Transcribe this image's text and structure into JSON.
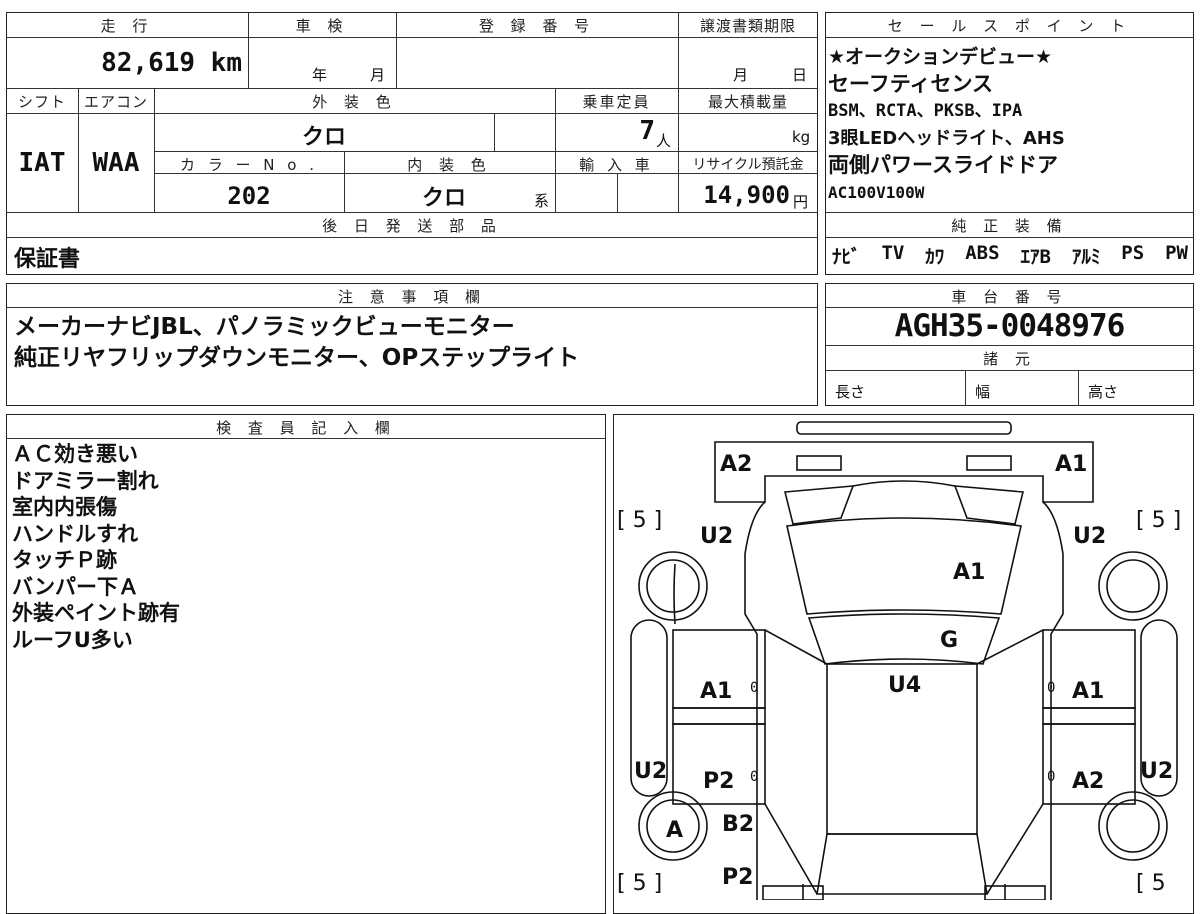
{
  "main": {
    "headers": {
      "mileage": "走 行",
      "inspection": "車 検",
      "registration": "登 録 番 号",
      "transfer_deadline": "譲渡書類期限",
      "shift": "シフト",
      "aircon": "エアコン",
      "ext_color": "外 装 色",
      "capacity": "乗車定員",
      "max_load": "最大積載量",
      "color_no": "カ ラ ー N o .",
      "int_color": "内 装 色",
      "import": "輸 入 車",
      "recycle": "リサイクル預託金",
      "later_parts": "後 日 発 送 部 品"
    },
    "mileage": "82,619 km",
    "inspection_year_unit": "年",
    "inspection_month_unit": "月",
    "transfer_month_unit": "月",
    "transfer_day_unit": "日",
    "shift": "IAT",
    "aircon": "WAA",
    "ext_color": "クロ",
    "capacity": "7",
    "capacity_unit": "人",
    "max_load_unit": "kg",
    "color_no": "202",
    "int_color": "クロ",
    "int_color_suffix": "系",
    "recycle": "14,900",
    "recycle_unit": "円",
    "later_parts": "保証書"
  },
  "sales": {
    "header": "セ ー ル ス ポ イ ン ト",
    "lines": [
      "★オークションデビュー★",
      "セーフティセンス",
      "BSM、RCTA、PKSB、IPA",
      "3眼LEDヘッドライト、AHS",
      "両側パワースライドドア",
      "AC100V100W"
    ]
  },
  "equipment": {
    "header": "純 正 装 備",
    "items": [
      "ﾅﾋﾞ",
      "TV",
      "ｶﾜ",
      "ABS",
      "ｴｱB",
      "ｱﾙﾐ",
      "PS",
      "PW"
    ]
  },
  "notes": {
    "header": "注 意 事 項 欄",
    "lines": [
      "メーカーナビJBL、パノラミックビューモニター",
      "純正リヤフリップダウンモニター、OPステップライト"
    ]
  },
  "chassis": {
    "header": "車 台 番 号",
    "number": "AGH35-0048976"
  },
  "specs": {
    "header": "諸 元",
    "length": "長さ",
    "width": "幅",
    "height": "高さ"
  },
  "inspector": {
    "header": "検 査 員 記 入 欄",
    "lines": [
      "ＡＣ効き悪い",
      "ドアミラー割れ",
      "室内内張傷",
      "ハンドルすれ",
      "タッチＰ跡",
      "バンパー下Ａ",
      "外装ペイント跡有",
      "ルーフU多い"
    ]
  },
  "diagram": {
    "bracket_left_top": "[ 5 ]",
    "bracket_right_top": "[ 5 ]",
    "bracket_left_bottom": "[ 5 ]",
    "bracket_right_bottom": "[ 5",
    "marks": {
      "front_left_corner": "A2",
      "front_right_corner": "A1",
      "left_fender": "U2",
      "right_fender": "U2",
      "hood": "A1",
      "windshield": "G",
      "roof": "U4",
      "left_front_door": "A1",
      "right_front_door": "A1",
      "left_rear_pillar": "U2",
      "right_rear_pillar": "U2",
      "left_rear_door": "P2",
      "right_rear_door": "A2",
      "left_rear_wheel": "A",
      "left_quarter": "B2",
      "left_rear_corner": "P2"
    },
    "zero_marks": [
      "0",
      "0",
      "0",
      "0"
    ]
  }
}
